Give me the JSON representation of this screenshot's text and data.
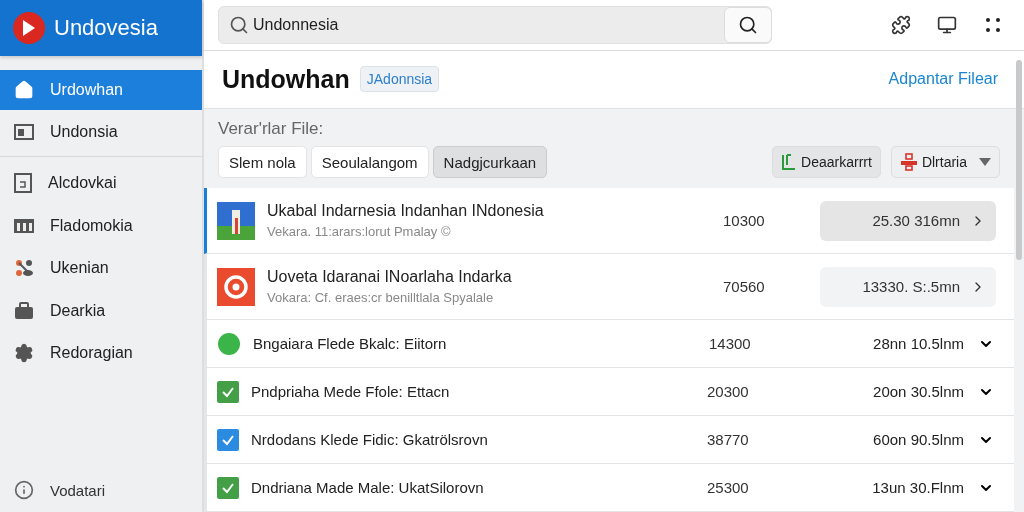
{
  "app": {
    "name": "Undovesia"
  },
  "sidebar": {
    "items": [
      {
        "label": "Urdowhan",
        "selected": true
      },
      {
        "label": "Undonsia",
        "selected": false
      },
      {
        "label": "Alcdovkai",
        "selected": false
      },
      {
        "label": "Fladomokia",
        "selected": false
      },
      {
        "label": "Ukenian",
        "selected": false
      },
      {
        "label": "Dearkia",
        "selected": false
      },
      {
        "label": "Redoragian",
        "selected": false
      }
    ],
    "footer": {
      "label": "Vodatari"
    }
  },
  "search": {
    "value": "Undonnesia"
  },
  "header": {
    "title": "Undowhan",
    "tag": "JAdonnsia",
    "link": "Adpantar Filear"
  },
  "filters": {
    "label": "Verar'rlar File:",
    "chips": [
      {
        "label": "Slem nola",
        "selected": false
      },
      {
        "label": "Seoulalangom",
        "selected": false
      },
      {
        "label": "Nadgjcurkaan",
        "selected": true
      }
    ],
    "actions": [
      {
        "label": "Deaarkarrrt",
        "kind": "export"
      },
      {
        "label": "Dlrtaria",
        "kind": "menu"
      }
    ]
  },
  "rows": [
    {
      "kind": "photo",
      "title": "Ukabal Indarnesia Indanhan  INdonesia",
      "subtitle": "Vekara. 11:arars:lorut Pmalay ©",
      "count": "10300",
      "value": "25.30  316mn",
      "selected": true
    },
    {
      "kind": "target",
      "title": "Uoveta Idaranai INoarlaha Indarka",
      "subtitle": "Vokara: Cf. eraes:cr benilltlala Spyalale",
      "count": "70560",
      "value": "13330. S:.5mn",
      "selected": false
    },
    {
      "kind": "dot",
      "color": "#3bb54a",
      "title": "Bngaiara Flede Bkalc: Eiitorn",
      "count": "14300",
      "value": "28nn 10.5lnm",
      "selected": false
    },
    {
      "kind": "check",
      "color": "#43a047",
      "title": "Pndpriaha Mede Ffole: Ettacn",
      "count": "20300",
      "value": "20on 30.5lnm",
      "selected": false
    },
    {
      "kind": "check",
      "color": "#2a8be0",
      "title": "Nrdodans Klede Fidic: Gkatrölsrovn",
      "count": "38770",
      "value": "60on 90.5lnm",
      "selected": false
    },
    {
      "kind": "check",
      "color": "#43a047",
      "title": "Dndriana Made Male: UkatSilorovn",
      "count": "25300",
      "value": "13un 30.Flnm",
      "selected": false
    }
  ]
}
